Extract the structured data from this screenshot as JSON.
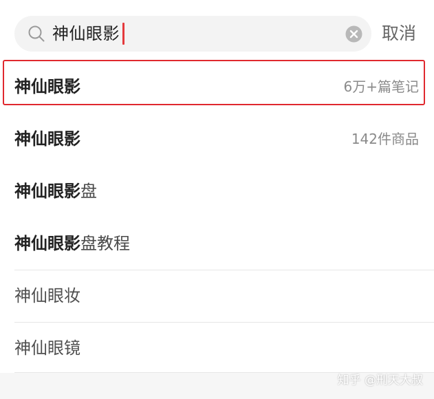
{
  "search": {
    "query": "神仙眼影",
    "cancel_label": "取消",
    "icon": "search-icon",
    "clear_icon": "clear-icon"
  },
  "suggestions": [
    {
      "bold": "神仙眼影",
      "rest": "",
      "meta": "6万+篇笔记",
      "highlighted": true
    },
    {
      "bold": "神仙眼影",
      "rest": "",
      "meta": "142件商品"
    },
    {
      "bold": "神仙眼影",
      "rest": "盘",
      "meta": ""
    },
    {
      "bold": "神仙眼影",
      "rest": "盘教程",
      "meta": ""
    },
    {
      "bold": "",
      "rest": "神仙眼妆",
      "meta": ""
    },
    {
      "bold": "",
      "rest": "神仙眼镜",
      "meta": ""
    }
  ],
  "colors": {
    "accent_caret": "#e4393c",
    "highlight_border": "#e0282e",
    "search_bg": "#f3f3f3"
  },
  "watermark": "知乎 @刑天大叔"
}
